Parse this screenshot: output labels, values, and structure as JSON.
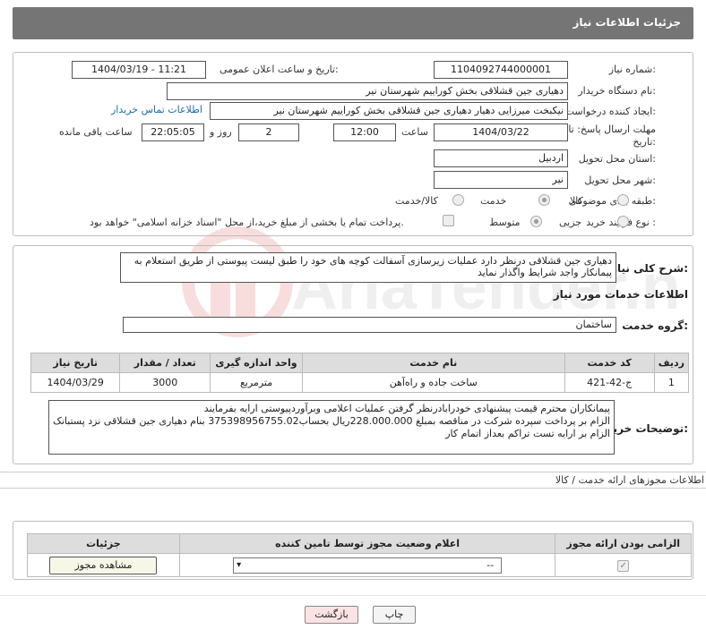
{
  "page": {
    "title": "جزئیات اطلاعات نیاز"
  },
  "fields": {
    "need_number_label": "شماره نیاز:",
    "need_number": "1104092744000001",
    "announce_label": "تاریخ و ساعت اعلان عمومی:",
    "announce_value": "1404/03/19 - 11:21",
    "buyer_org_label": "نام دستگاه خریدار:",
    "buyer_org": "دهیاری جین قشلاقی بخش کوراییم شهرستان نیر",
    "creator_label": "ایجاد کننده درخواست:",
    "creator": "نیکبخت میرزایی دهیار دهیاری جین قشلاقی بخش کوراییم شهرستان نیر",
    "contact_link": "اطلاعات تماس خریدار",
    "deadline_label_1": "مهلت ارسال پاسخ: تا",
    "deadline_label_2": "تاریخ:",
    "deadline_date": "1404/03/22",
    "time_label": "ساعت",
    "deadline_time": "12:00",
    "days_value": "2",
    "days_label": "روز و",
    "remaining_time": "22:05:05",
    "remaining_label": "ساعت باقی مانده",
    "province_label": "استان محل تحویل:",
    "province": "اردبیل",
    "city_label": "شهر محل تحویل:",
    "city": "نیر",
    "category_label": "طبقه بندی موضوعی:",
    "category_options": [
      "کالا",
      "خدمت",
      "کالا/خدمت"
    ],
    "category_selected": "خدمت",
    "process_label": "نوع فرآیند خرید :",
    "process_options": [
      "جزیی",
      "متوسط"
    ],
    "process_selected": "جزیی",
    "payment_note": "پرداخت تمام یا بخشی از مبلغ خرید،از محل \"اسناد خزانه اسلامی\" خواهد بود."
  },
  "summary": {
    "label": "شرح کلی نیاز:",
    "text": "دهیاری جین قشلاقی درنظر دارد عملیات زیرسازی آسفالت کوچه های خود را طبق لیست پیوستی از طریق استعلام به پیمانکار واجد شرایط واگذار نماید"
  },
  "services": {
    "section_title": "اطلاعات خدمات مورد نیاز",
    "group_label": "گروه خدمت:",
    "group_value": "ساختمان",
    "columns": [
      "ردیف",
      "کد خدمت",
      "نام خدمت",
      "واحد اندازه گیری",
      "تعداد / مقدار",
      "تاریخ نیاز"
    ],
    "rows": [
      [
        "1",
        "ج-42-421",
        "ساخت جاده و راه‌آهن",
        "مترمربع",
        "3000",
        "1404/03/29"
      ]
    ]
  },
  "buyer_notes": {
    "label": "توضیحات خریدار:",
    "lines": [
      "پیمانکاران محترم قیمت پیشنهادی خودرابادرنظر گرفتن عملیات اعلامی وبرآوردپیوستی ارایه بفرمایند",
      "الزام بر پرداخت سپردە شرکت در مناقصه بمبلغ 228.000.000ریال بحساب375398956755.02 بنام دهیاری جین قشلاقی نزد پستبانک",
      "الزام بر ارایه تست تراکم بعداز اتمام کار"
    ]
  },
  "permits": {
    "section_title": "اطلاعات مجوزهای ارائه خدمت / کالا",
    "columns": [
      "الزامی بودن ارائه مجوز",
      "اعلام وضعیت مجوز توسط تامین کننده",
      "جزئیات"
    ],
    "select_value": "--",
    "view_button": "مشاهده مجوز"
  },
  "actions": {
    "print": "چاپ",
    "back": "بازگشت"
  },
  "watermark": {
    "text": "AriaTender.net"
  },
  "colors": {
    "header": "#757575",
    "back_button_bg": "#fbe3e3",
    "link": "#1a6fb0"
  }
}
